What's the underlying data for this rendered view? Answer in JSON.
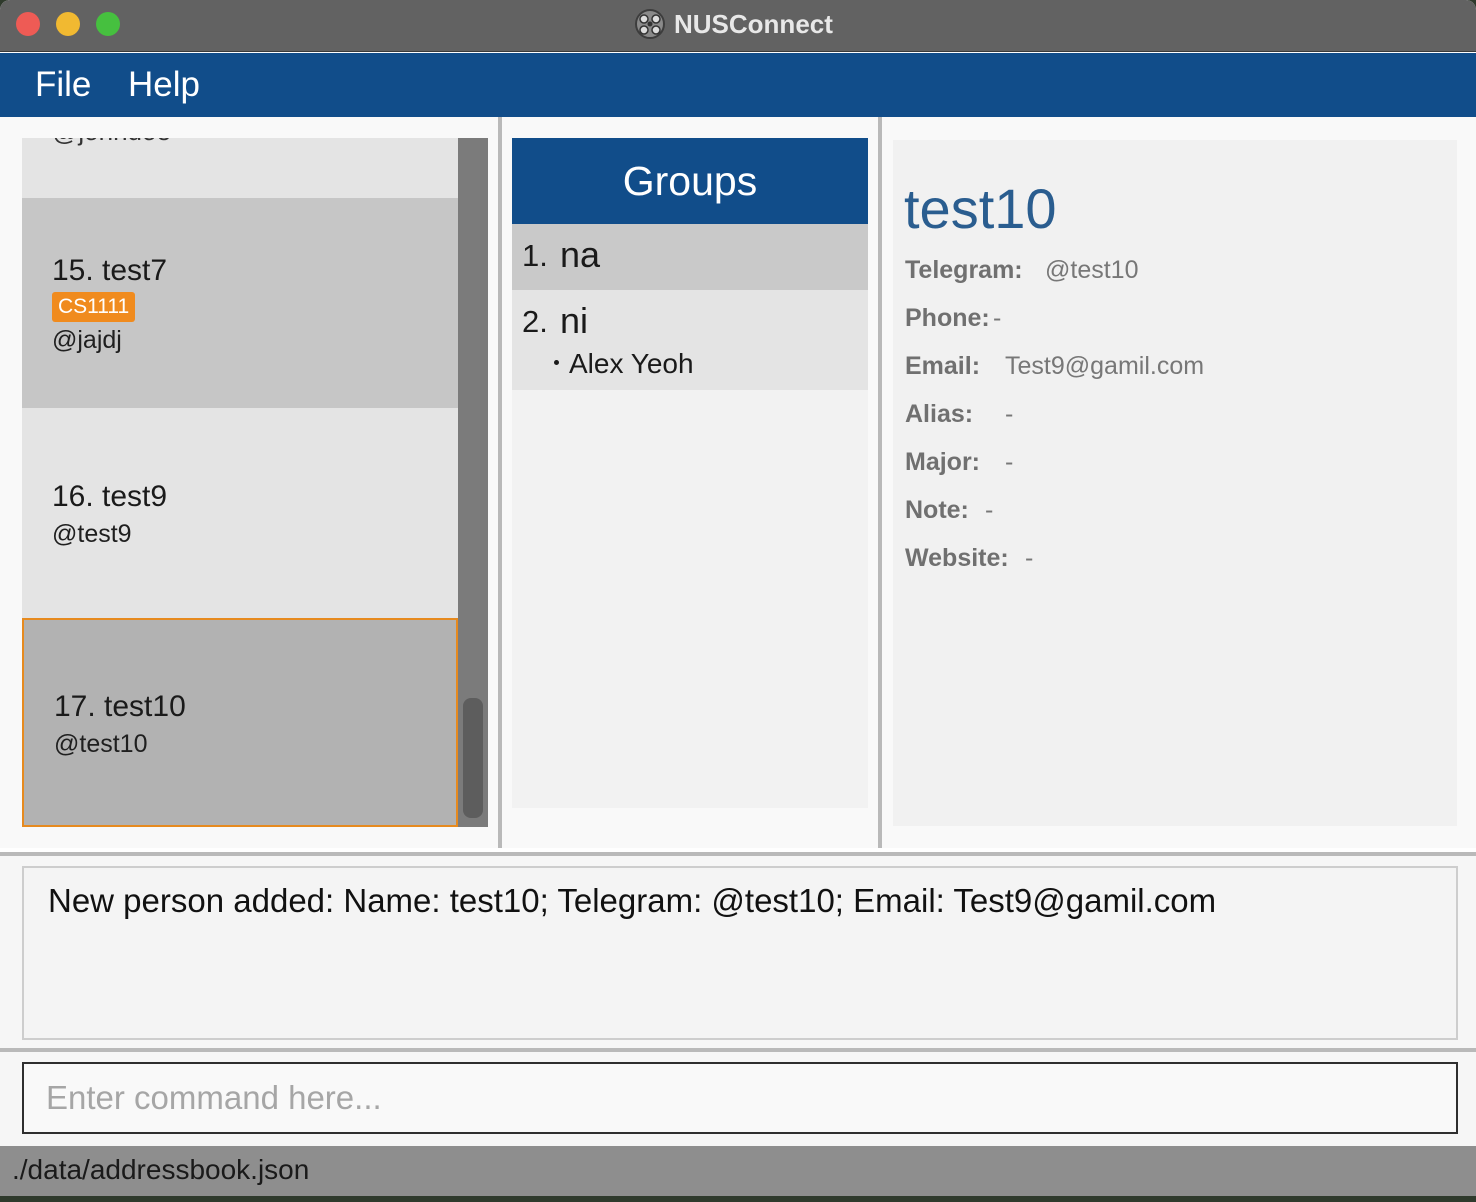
{
  "window": {
    "title": "NUSConnect",
    "app_icon": "nusconnect-logo-icon"
  },
  "menu": {
    "file": "File",
    "help": "Help"
  },
  "persons": {
    "partial_handle": "@johndoe",
    "items": [
      {
        "label": "15. test7",
        "tags": [
          "CS1111"
        ],
        "handle": "@jajdj"
      },
      {
        "label": "16. test9",
        "tags": [],
        "handle": "@test9"
      },
      {
        "label": "17. test10",
        "tags": [],
        "handle": "@test10",
        "selected": true
      }
    ]
  },
  "groups": {
    "header": "Groups",
    "items": [
      {
        "index": "1.",
        "name": "na",
        "members": []
      },
      {
        "index": "2.",
        "name": "ni",
        "members": [
          "Alex Yeoh"
        ]
      }
    ]
  },
  "detail": {
    "name": "test10",
    "fields": [
      {
        "label": "Telegram:",
        "value": "@test10"
      },
      {
        "label": "Phone:",
        "value": "-"
      },
      {
        "label": "Email:",
        "value": "Test9@gamil.com"
      },
      {
        "label": "Alias:",
        "value": "-"
      },
      {
        "label": "Major:",
        "value": "-"
      },
      {
        "label": "Note:",
        "value": "-"
      },
      {
        "label": "Website:",
        "value": "-"
      }
    ]
  },
  "result": {
    "text": "New person added: Name: test10; Telegram: @test10; Email: Test9@gamil.com"
  },
  "command": {
    "value": "",
    "placeholder": "Enter command here..."
  },
  "status": {
    "path": "./data/addressbook.json"
  },
  "colors": {
    "accent": "#114d8a",
    "tag": "#f08b1e",
    "selection_border": "#e68a1f",
    "detail_name": "#2a5d8f"
  }
}
